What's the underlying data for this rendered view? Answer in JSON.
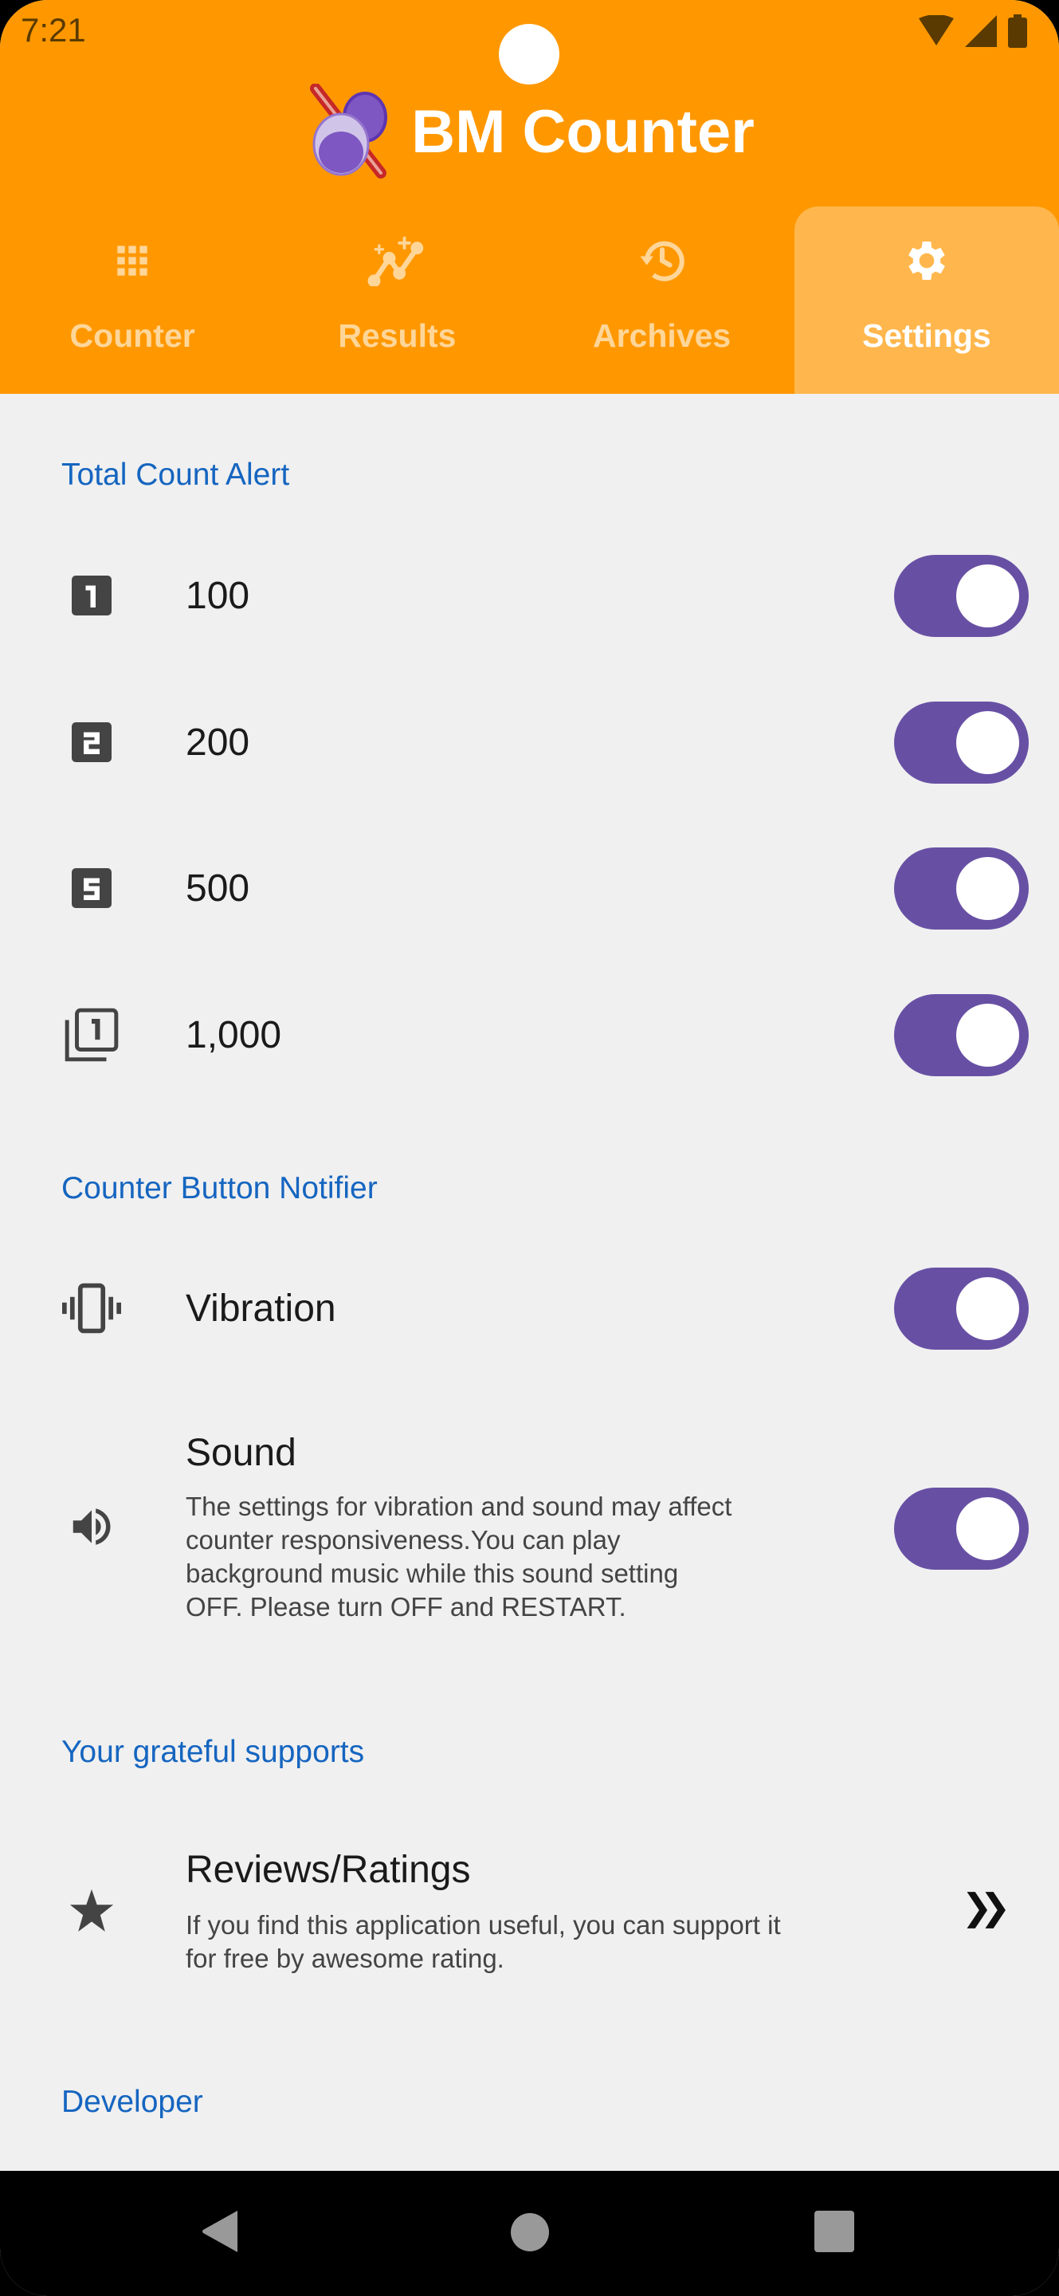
{
  "status_bar": {
    "time": "7:21"
  },
  "app": {
    "title": "BM Counter"
  },
  "tabs": [
    {
      "label": "Counter",
      "icon": "grid-icon",
      "active": false
    },
    {
      "label": "Results",
      "icon": "insights-icon",
      "active": false
    },
    {
      "label": "Archives",
      "icon": "history-icon",
      "active": false
    },
    {
      "label": "Settings",
      "icon": "gear-icon",
      "active": true
    }
  ],
  "sections": {
    "total_count_alert": {
      "heading": "Total Count Alert",
      "items": [
        {
          "label": "100",
          "icon": "looks-one-icon",
          "enabled": true
        },
        {
          "label": "200",
          "icon": "looks-two-icon",
          "enabled": true
        },
        {
          "label": "500",
          "icon": "looks-five-icon",
          "enabled": true
        },
        {
          "label": "1,000",
          "icon": "filter-one-icon",
          "enabled": true
        }
      ]
    },
    "counter_button_notifier": {
      "heading": "Counter Button Notifier",
      "vibration": {
        "label": "Vibration",
        "icon": "vibration-icon",
        "enabled": true
      },
      "sound": {
        "label": "Sound",
        "icon": "volume-icon",
        "enabled": true,
        "description_lines": [
          "The settings for vibration and sound may affect",
          "counter responsiveness.You can play",
          "background music while this sound setting",
          "OFF. Please turn OFF and RESTART."
        ]
      }
    },
    "supports": {
      "heading": "Your grateful supports",
      "reviews": {
        "title": "Reviews/Ratings",
        "icon": "star-icon",
        "description_lines": [
          "If you find this application useful, you can support it",
          "for free by awesome rating."
        ]
      }
    },
    "developer": {
      "heading": "Developer"
    }
  },
  "colors": {
    "header": "#FF9800",
    "active_tab": "#FFB74D",
    "section_heading": "#1565C0",
    "toggle_on": "#6750A4",
    "background": "#F0F0F0"
  }
}
